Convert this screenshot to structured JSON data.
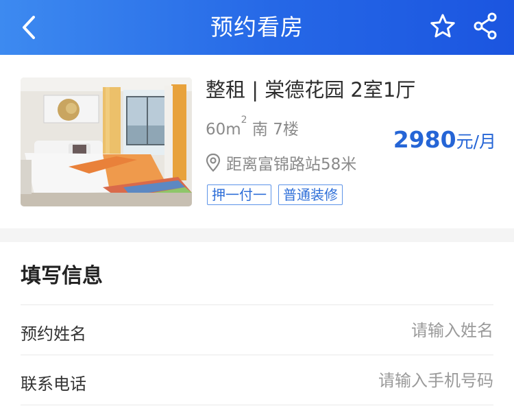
{
  "header": {
    "title": "预约看房",
    "back_icon": "chevron-left-icon",
    "favorite_icon": "star-icon",
    "share_icon": "share-icon",
    "background": "#2567e6"
  },
  "listing": {
    "title": "整租 | 棠德花园 2室1厅",
    "area": "60m",
    "area_unit_sup": "2",
    "orientation_floor": " 南 7楼",
    "distance": "距离富锦路站58米",
    "location_icon": "location-pin-icon",
    "tags": [
      "押一付一",
      "普通装修"
    ],
    "price": "2980",
    "price_unit": "元/月",
    "price_color": "#2565d6"
  },
  "form": {
    "title": "填写信息",
    "name_label": "预约姓名",
    "name_placeholder": "请输入姓名",
    "phone_label": "联系电话",
    "phone_placeholder": "请输入手机号码"
  }
}
